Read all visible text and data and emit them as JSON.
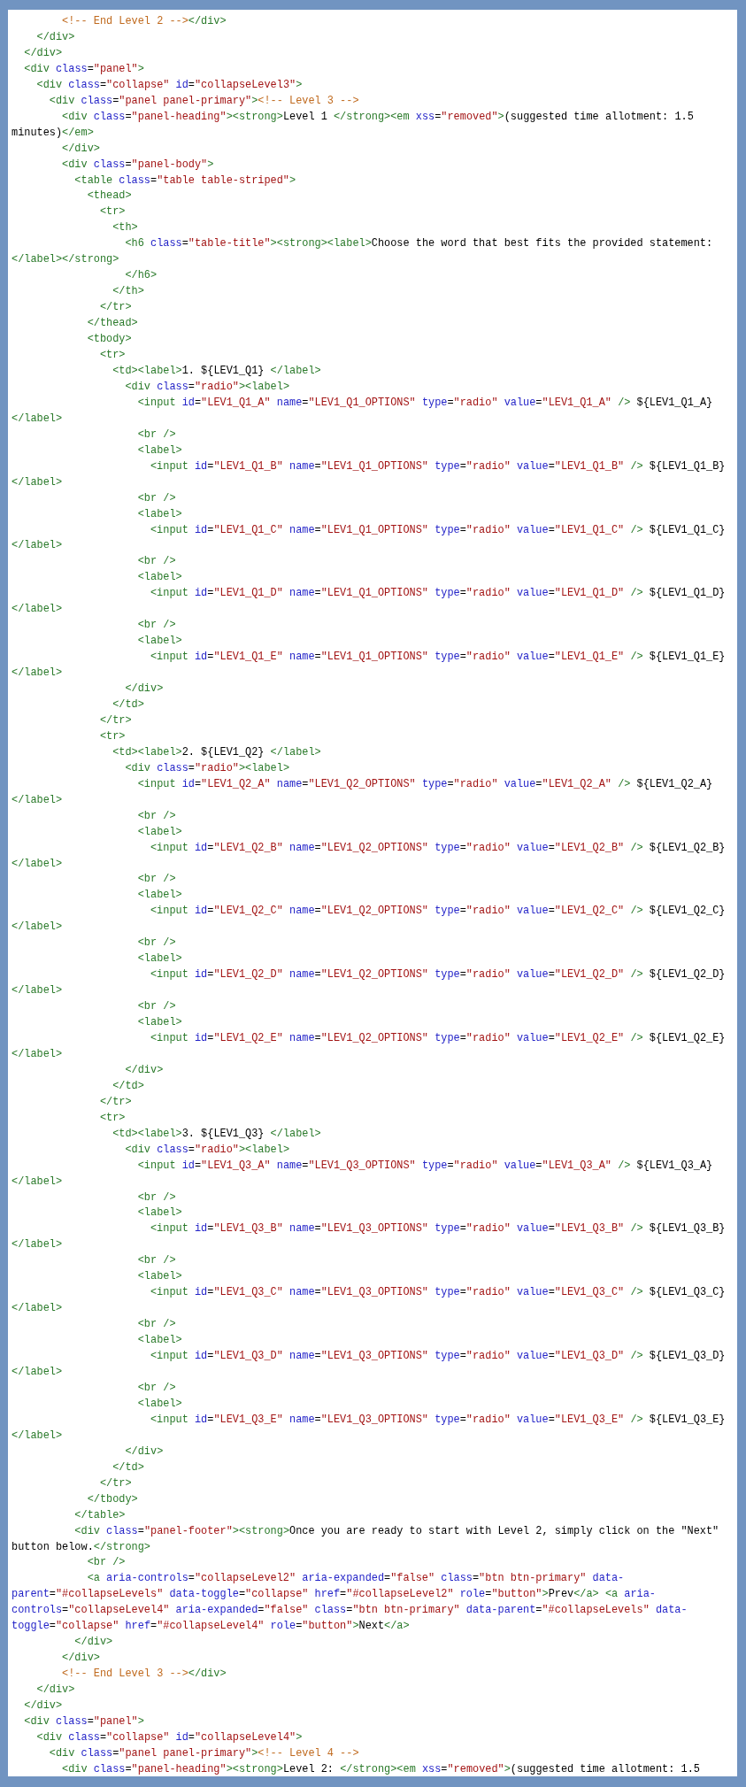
{
  "code_lines": [
    "        <!-- End Level 2 --></div>",
    "    </div>",
    "  </div>",
    "  <div class=\"panel\">",
    "    <div class=\"collapse\" id=\"collapseLevel3\">",
    "      <div class=\"panel panel-primary\"><!-- Level 3 -->",
    "        <div class=\"panel-heading\"><strong>Level 1 </strong><em xss=\"removed\">(suggested time allotment: 1.5 minutes)</em>",
    "        </div>",
    "        <div class=\"panel-body\">",
    "          <table class=\"table table-striped\">",
    "            <thead>",
    "              <tr>",
    "                <th>",
    "                  <h6 class=\"table-title\"><strong><label>Choose the word that best fits the provided statement: </label></strong>",
    "                  </h6>",
    "                </th>",
    "              </tr>",
    "            </thead>",
    "            <tbody>",
    "              <tr>",
    "                <td><label>1. ${LEV1_Q1} </label>",
    "                  <div class=\"radio\"><label>",
    "                    <input id=\"LEV1_Q1_A\" name=\"LEV1_Q1_OPTIONS\" type=\"radio\" value=\"LEV1_Q1_A\" /> ${LEV1_Q1_A} </label>",
    "                    <br />",
    "                    <label>",
    "                      <input id=\"LEV1_Q1_B\" name=\"LEV1_Q1_OPTIONS\" type=\"radio\" value=\"LEV1_Q1_B\" /> ${LEV1_Q1_B} </label>",
    "                    <br />",
    "                    <label>",
    "                      <input id=\"LEV1_Q1_C\" name=\"LEV1_Q1_OPTIONS\" type=\"radio\" value=\"LEV1_Q1_C\" /> ${LEV1_Q1_C} </label>",
    "                    <br />",
    "                    <label>",
    "                      <input id=\"LEV1_Q1_D\" name=\"LEV1_Q1_OPTIONS\" type=\"radio\" value=\"LEV1_Q1_D\" /> ${LEV1_Q1_D} </label>",
    "                    <br />",
    "                    <label>",
    "                      <input id=\"LEV1_Q1_E\" name=\"LEV1_Q1_OPTIONS\" type=\"radio\" value=\"LEV1_Q1_E\" /> ${LEV1_Q1_E} </label>",
    "                  </div>",
    "                </td>",
    "              </tr>",
    "              <tr>",
    "                <td><label>2. ${LEV1_Q2} </label>",
    "                  <div class=\"radio\"><label>",
    "                    <input id=\"LEV1_Q2_A\" name=\"LEV1_Q2_OPTIONS\" type=\"radio\" value=\"LEV1_Q2_A\" /> ${LEV1_Q2_A} </label>",
    "                    <br />",
    "                    <label>",
    "                      <input id=\"LEV1_Q2_B\" name=\"LEV1_Q2_OPTIONS\" type=\"radio\" value=\"LEV1_Q2_B\" /> ${LEV1_Q2_B} </label>",
    "                    <br />",
    "                    <label>",
    "                      <input id=\"LEV1_Q2_C\" name=\"LEV1_Q2_OPTIONS\" type=\"radio\" value=\"LEV1_Q2_C\" /> ${LEV1_Q2_C} </label>",
    "                    <br />",
    "                    <label>",
    "                      <input id=\"LEV1_Q2_D\" name=\"LEV1_Q2_OPTIONS\" type=\"radio\" value=\"LEV1_Q2_D\" /> ${LEV1_Q2_D} </label>",
    "                    <br />",
    "                    <label>",
    "                      <input id=\"LEV1_Q2_E\" name=\"LEV1_Q2_OPTIONS\" type=\"radio\" value=\"LEV1_Q2_E\" /> ${LEV1_Q2_E} </label>",
    "                  </div>",
    "                </td>",
    "              </tr>",
    "              <tr>",
    "                <td><label>3. ${LEV1_Q3} </label>",
    "                  <div class=\"radio\"><label>",
    "                    <input id=\"LEV1_Q3_A\" name=\"LEV1_Q3_OPTIONS\" type=\"radio\" value=\"LEV1_Q3_A\" /> ${LEV1_Q3_A} </label>",
    "                    <br />",
    "                    <label>",
    "                      <input id=\"LEV1_Q3_B\" name=\"LEV1_Q3_OPTIONS\" type=\"radio\" value=\"LEV1_Q3_B\" /> ${LEV1_Q3_B} </label>",
    "                    <br />",
    "                    <label>",
    "                      <input id=\"LEV1_Q3_C\" name=\"LEV1_Q3_OPTIONS\" type=\"radio\" value=\"LEV1_Q3_C\" /> ${LEV1_Q3_C} </label>",
    "                    <br />",
    "                    <label>",
    "                      <input id=\"LEV1_Q3_D\" name=\"LEV1_Q3_OPTIONS\" type=\"radio\" value=\"LEV1_Q3_D\" /> ${LEV1_Q3_D} </label>",
    "                    <br />",
    "                    <label>",
    "                      <input id=\"LEV1_Q3_E\" name=\"LEV1_Q3_OPTIONS\" type=\"radio\" value=\"LEV1_Q3_E\" /> ${LEV1_Q3_E} </label>",
    "                  </div>",
    "                </td>",
    "              </tr>",
    "            </tbody>",
    "          </table>",
    "          <div class=\"panel-footer\"><strong>Once you are ready to start with Level 2, simply click on the \"Next\" button below.</strong>",
    "            <br />",
    "            <a aria-controls=\"collapseLevel2\" aria-expanded=\"false\" class=\"btn btn-primary\" data-parent=\"#collapseLevels\" data-toggle=\"collapse\" href=\"#collapseLevel2\" role=\"button\">Prev</a> <a aria-controls=\"collapseLevel4\" aria-expanded=\"false\" class=\"btn btn-primary\" data-parent=\"#collapseLevels\" data-toggle=\"collapse\" href=\"#collapseLevel4\" role=\"button\">Next</a>",
    "          </div>",
    "        </div>",
    "        <!-- End Level 3 --></div>",
    "    </div>",
    "  </div>",
    "  <div class=\"panel\">",
    "    <div class=\"collapse\" id=\"collapseLevel4\">",
    "      <div class=\"panel panel-primary\"><!-- Level 4 -->",
    "        <div class=\"panel-heading\"><strong>Level 2: </strong><em xss=\"removed\">(suggested time allotment: 1.5"
  ]
}
